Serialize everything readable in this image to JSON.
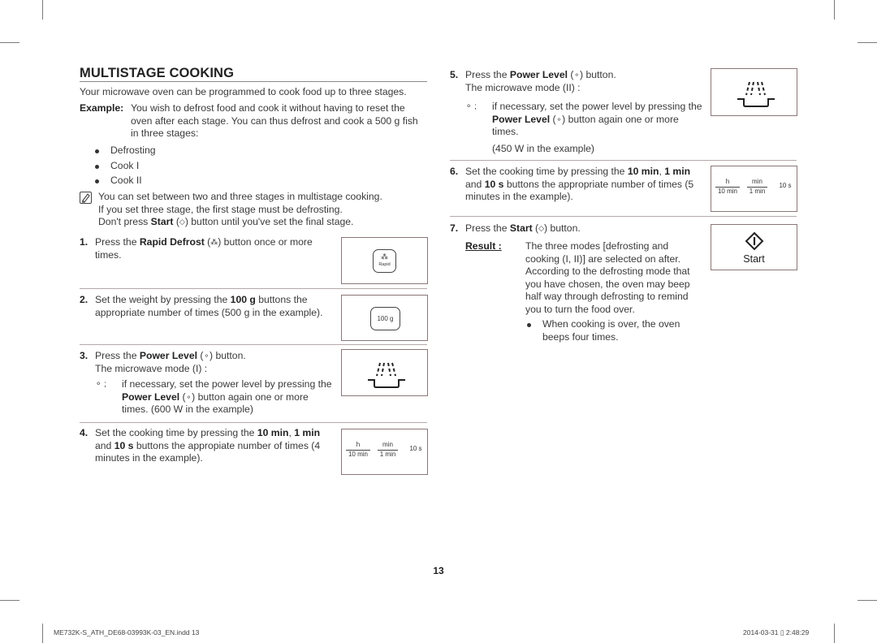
{
  "page": {
    "title": "MULTISTAGE COOKING",
    "intro": "Your microwave oven can be programmed to cook food up to three stages.",
    "example": {
      "label": "Example:",
      "text": "You wish to defrost food and cook it without having to reset the oven after each stage. You can thus defrost and cook a 500 g fish in three stages:"
    },
    "stages": [
      "Defrosting",
      "Cook I",
      "Cook II"
    ],
    "note": {
      "icon": "note-pencil-icon",
      "line1": "You can set between two and three stages in multistage cooking.",
      "line2": "If you set three stage, the first stage must be defrosting.",
      "line3_pre": "Don't press ",
      "line3_bold": "Start",
      "line3_post": " button until you've set the final stage."
    },
    "page_number": "13"
  },
  "steps": [
    {
      "num": "1.",
      "pre": "Press the ",
      "bold": "Rapid Defrost",
      "post": " button once or more times.",
      "panel": {
        "type": "rapid-defrost-button",
        "label": "Rapid"
      }
    },
    {
      "num": "2.",
      "pre": "Set the weight by pressing the ",
      "bold": "100 g",
      "post": " buttons the appropriate number of times (500 g in the example).",
      "panel": {
        "type": "weight-button",
        "label": "100 g"
      }
    },
    {
      "num": "3.",
      "pre": "Press the ",
      "bold": "Power Level",
      "post": " button.",
      "line2": "The microwave mode (I) :",
      "sub_pre": "if necessary, set the power level by pressing the ",
      "sub_bold": "Power Level",
      "sub_post": " button again one or more times. (600 W in the example)",
      "panel": {
        "type": "microwave-icon"
      }
    },
    {
      "num": "4.",
      "pre": "Set the cooking time by pressing the ",
      "bold1": "10 min",
      "mid1": ", ",
      "bold2": "1 min",
      "mid2": " and ",
      "bold3": "10 s",
      "post": " buttons the appropiate number of times (4 minutes in the example).",
      "panel": {
        "type": "time-buttons",
        "h": "h",
        "ten_min": "10 min",
        "min": "min",
        "one_min": "1 min",
        "ten_s": "10 s"
      }
    },
    {
      "num": "5.",
      "pre": "Press the ",
      "bold": "Power Level",
      "post": " button.",
      "line2": "The microwave mode (II) :",
      "sub_pre": "if necessary, set the power level by pressing the ",
      "sub_bold": "Power Level",
      "sub_post": " button again one or more times.",
      "sub_extra": "(450 W in the example)",
      "panel": {
        "type": "microwave-icon"
      }
    },
    {
      "num": "6.",
      "pre": "Set the cooking time by pressing the ",
      "bold1": "10 min",
      "mid1": ", ",
      "bold2": "1 min",
      "mid2": " and ",
      "bold3": "10 s",
      "post": " buttons the appropriate number of times (5 minutes in the example).",
      "panel": {
        "type": "time-buttons",
        "h": "h",
        "ten_min": "10 min",
        "min": "min",
        "one_min": "1 min",
        "ten_s": "10 s"
      }
    },
    {
      "num": "7.",
      "pre": "Press the ",
      "bold": "Start",
      "post": " button.",
      "result_label": "Result :",
      "result_text": "The three modes [defrosting and cooking (I, II)] are selected on after. According to the defrosting mode that you have chosen, the oven may beep half way through defrosting to remind you to turn the food over.",
      "result_bullet": "When cooking is over, the oven beeps four times.",
      "panel": {
        "type": "start-button",
        "label": "Start"
      }
    }
  ],
  "footer": {
    "file": "ME732K-S_ATH_DE68-03993K-03_EN.indd   13",
    "datetime": "2014-03-31   ▯ 2:48:29"
  },
  "colors": {
    "text": "#3a3a3a",
    "heading": "#222222",
    "divider": "#b6a8a8",
    "panel_border": "#8a7878"
  }
}
